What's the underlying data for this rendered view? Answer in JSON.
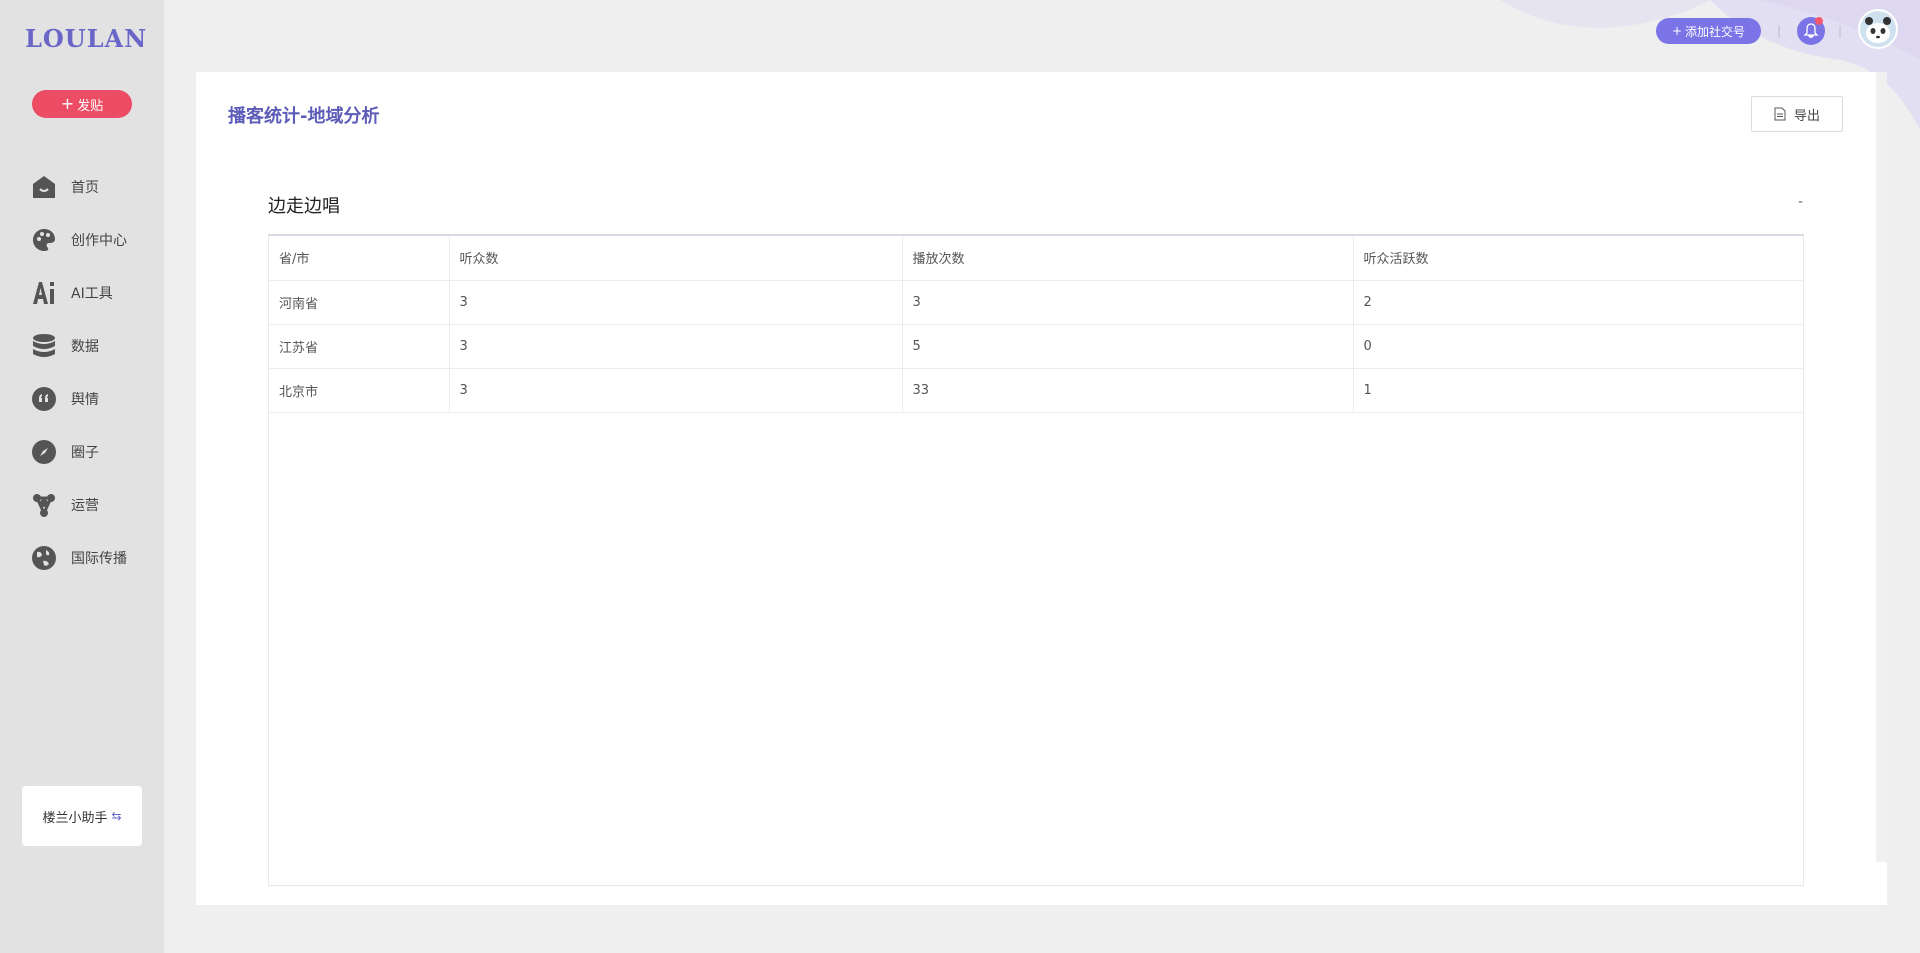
{
  "app": {
    "logo": "LOULAN"
  },
  "sidebar": {
    "post_button": "发贴",
    "items": [
      {
        "label": "首页",
        "icon": "home-icon"
      },
      {
        "label": "创作中心",
        "icon": "palette-icon"
      },
      {
        "label": "AI工具",
        "icon": "ai-icon"
      },
      {
        "label": "数据",
        "icon": "database-icon"
      },
      {
        "label": "舆情",
        "icon": "quote-icon"
      },
      {
        "label": "圈子",
        "icon": "compass-icon"
      },
      {
        "label": "运营",
        "icon": "network-icon"
      },
      {
        "label": "国际传播",
        "icon": "globe-icon"
      }
    ],
    "assistant_label": "楼兰小助手"
  },
  "topbar": {
    "add_account_label": "添加社交号",
    "separator": "|"
  },
  "main": {
    "title": "播客统计-地域分析",
    "export_label": "导出",
    "section_title": "边走边唱",
    "section_extra": "-",
    "table": {
      "headers": [
        "省/市",
        "听众数",
        "播放次数",
        "听众活跃数"
      ],
      "rows": [
        [
          "河南省",
          "3",
          "3",
          "2"
        ],
        [
          "江苏省",
          "3",
          "5",
          "0"
        ],
        [
          "北京市",
          "3",
          "33",
          "1"
        ]
      ]
    }
  },
  "colors": {
    "accent": "#7b74e6",
    "title": "#5d5cb8",
    "post_button": "#ec4d65",
    "sidebar_bg": "#e2e2e2"
  }
}
